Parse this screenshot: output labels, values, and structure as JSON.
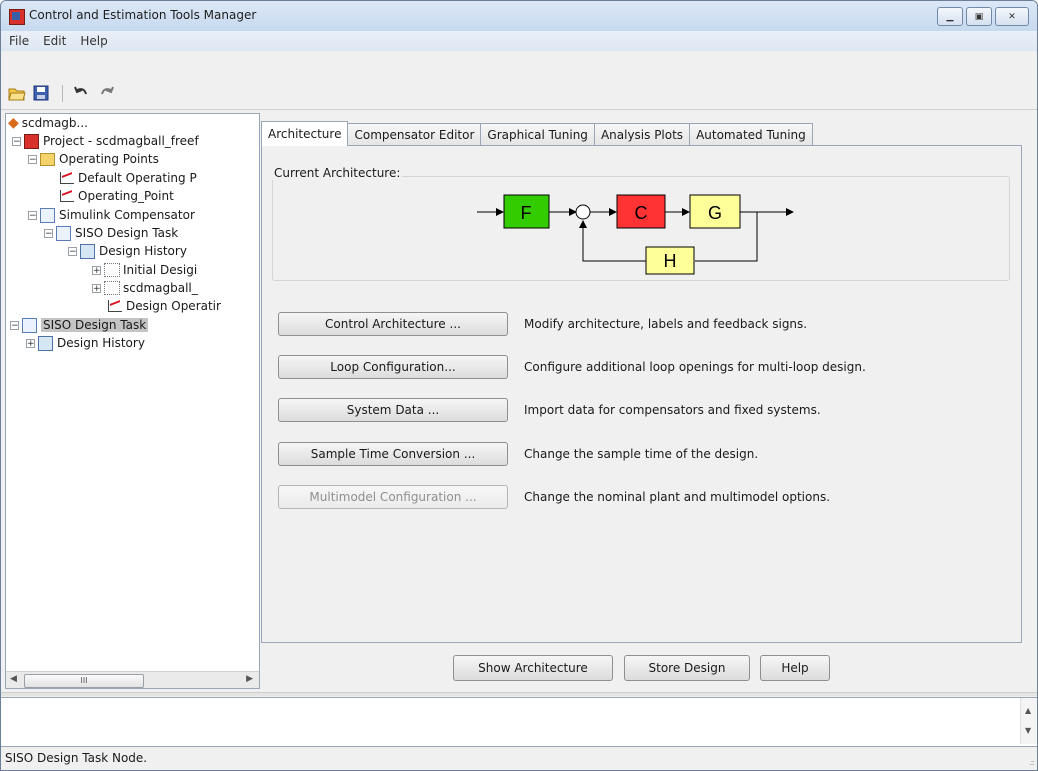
{
  "window": {
    "title": "Control and Estimation Tools Manager"
  },
  "menu": [
    "File",
    "Edit",
    "Help"
  ],
  "toolbar": [
    "open-icon",
    "save-icon",
    "undo-icon",
    "redo-icon"
  ],
  "tree": {
    "items": [
      {
        "label": "scdmagb...",
        "icon": "matlab-icon"
      },
      {
        "label": "Project - scdmagball_freef",
        "icon": "project-icon"
      },
      {
        "label": "Operating Points",
        "icon": "folder-icon"
      },
      {
        "label": "Default Operating P",
        "icon": "plot-icon"
      },
      {
        "label": "Operating_Point",
        "icon": "plot-icon"
      },
      {
        "label": "Simulink Compensator",
        "icon": "task-icon"
      },
      {
        "label": "SISO Design Task",
        "icon": "task-icon"
      },
      {
        "label": "Design History",
        "icon": "history-icon"
      },
      {
        "label": "Initial Desigi",
        "icon": "design-icon"
      },
      {
        "label": "scdmagball_",
        "icon": "design-icon"
      },
      {
        "label": "Design Operatir",
        "icon": "plot-icon"
      },
      {
        "label": "SISO Design Task",
        "icon": "task-icon",
        "selected": true
      },
      {
        "label": "Design History",
        "icon": "history-icon"
      }
    ],
    "scroll_thumb": "III"
  },
  "tabs": [
    {
      "label": "Architecture",
      "active": true
    },
    {
      "label": "Compensator Editor"
    },
    {
      "label": "Graphical Tuning"
    },
    {
      "label": "Analysis Plots"
    },
    {
      "label": "Automated Tuning"
    }
  ],
  "architecture": {
    "group_label": "Current Architecture:",
    "blocks": [
      {
        "label": "F",
        "color": "#33cc00"
      },
      {
        "label": "C",
        "color": "#ff3333"
      },
      {
        "label": "G",
        "color": "#ffff99"
      },
      {
        "label": "H",
        "color": "#ffff99"
      }
    ]
  },
  "actions": [
    {
      "button": "Control Architecture ...",
      "description": "Modify architecture, labels and feedback signs.",
      "enabled": true
    },
    {
      "button": "Loop Configuration...",
      "description": "Configure additional loop openings for multi-loop design.",
      "enabled": true
    },
    {
      "button": "System Data ...",
      "description": "Import data for compensators and fixed systems.",
      "enabled": true
    },
    {
      "button": "Sample Time Conversion ...",
      "description": "Change the sample time of the design.",
      "enabled": true
    },
    {
      "button": "Multimodel Configuration ...",
      "description": "Change the nominal plant and multimodel options.",
      "enabled": false
    }
  ],
  "bottom_buttons": [
    "Show Architecture",
    "Store Design",
    "Help"
  ],
  "status": "SISO Design Task Node."
}
